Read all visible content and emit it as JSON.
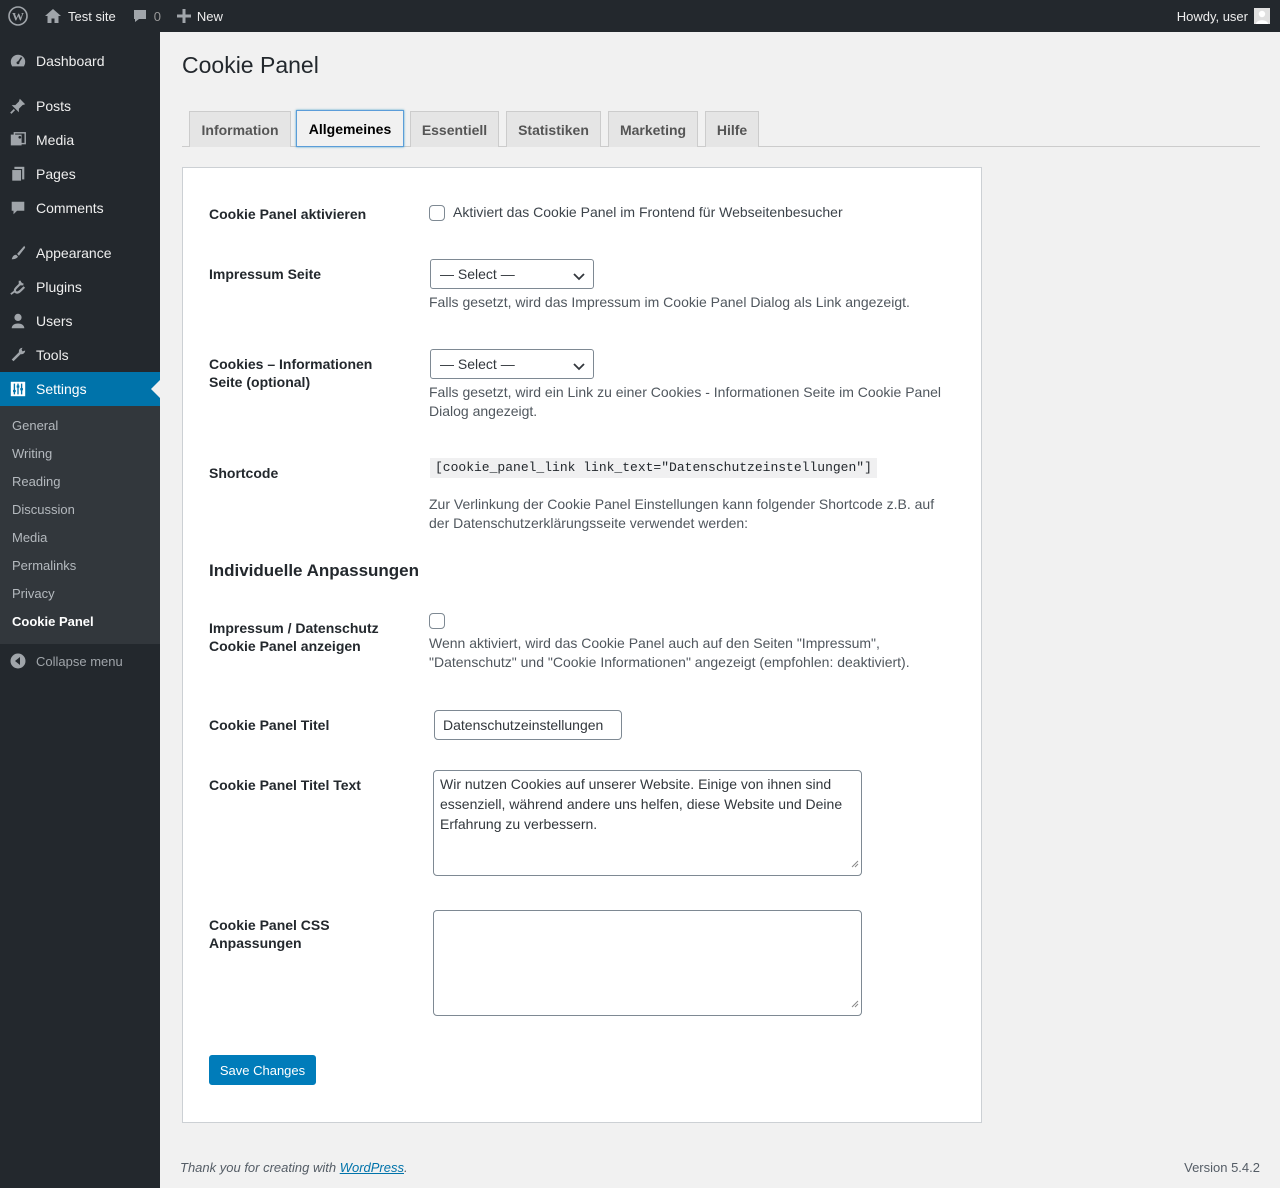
{
  "adminbar": {
    "site_name": "Test site",
    "comments_count": "0",
    "new_label": "New",
    "howdy": "Howdy, user"
  },
  "sidebar": {
    "items": [
      {
        "label": "Dashboard",
        "icon": "dashboard-icon"
      },
      {
        "label": "Posts",
        "icon": "pin-icon"
      },
      {
        "label": "Media",
        "icon": "media-icon"
      },
      {
        "label": "Pages",
        "icon": "pages-icon"
      },
      {
        "label": "Comments",
        "icon": "comment-icon"
      },
      {
        "label": "Appearance",
        "icon": "brush-icon"
      },
      {
        "label": "Plugins",
        "icon": "plug-icon"
      },
      {
        "label": "Users",
        "icon": "user-icon"
      },
      {
        "label": "Tools",
        "icon": "wrench-icon"
      },
      {
        "label": "Settings",
        "icon": "sliders-icon"
      }
    ],
    "submenu": [
      "General",
      "Writing",
      "Reading",
      "Discussion",
      "Media",
      "Permalinks",
      "Privacy",
      "Cookie Panel"
    ],
    "collapse_label": "Collapse menu"
  },
  "page": {
    "title": "Cookie Panel",
    "tabs": [
      "Information",
      "Allgemeines",
      "Essentiell",
      "Statistiken",
      "Marketing",
      "Hilfe"
    ],
    "active_tab": "Allgemeines"
  },
  "form": {
    "activate": {
      "label": "Cookie Panel aktivieren",
      "checkbox_label": "Aktiviert das Cookie Panel im Frontend für Webseitenbesucher"
    },
    "impressum": {
      "label": "Impressum Seite",
      "select_value": "— Select —",
      "description": "Falls gesetzt, wird das Impressum im Cookie Panel Dialog als Link angezeigt."
    },
    "cookies_info": {
      "label": "Cookies – Informationen Seite (optional)",
      "select_value": "— Select —",
      "description": "Falls gesetzt, wird ein Link zu einer Cookies - Informationen Seite im Cookie Panel Dialog angezeigt."
    },
    "shortcode": {
      "label": "Shortcode",
      "code": "[cookie_panel_link link_text=\"Datenschutzeinstellungen\"]",
      "description": "Zur Verlinkung der Cookie Panel Einstellungen kann folgender Shortcode z.B. auf der Datenschutzerklärungsseite verwendet werden:"
    },
    "section_heading": "Individuelle Anpassungen",
    "show_on_pages": {
      "label": "Impressum / Datenschutz Cookie Panel anzeigen",
      "description": "Wenn aktiviert, wird das Cookie Panel auch auf den Seiten \"Impressum\", \"Datenschutz\" und \"Cookie Informationen\" angezeigt (empfohlen: deaktiviert)."
    },
    "title": {
      "label": "Cookie Panel Titel",
      "value": "Datenschutzeinstellungen"
    },
    "title_text": {
      "label": "Cookie Panel Titel Text",
      "value": "Wir nutzen Cookies auf unserer Website. Einige von ihnen sind essenziell, während andere uns helfen, diese Website und Deine Erfahrung zu verbessern."
    },
    "css": {
      "label": "Cookie Panel CSS Anpassungen",
      "value": ""
    },
    "save_label": "Save Changes"
  },
  "footer": {
    "thanks_prefix": "Thank you for creating with ",
    "thanks_link": "WordPress",
    "thanks_suffix": ".",
    "version": "Version 5.4.2"
  },
  "colors": {
    "admin_dark": "#23282d",
    "accent": "#0073aa",
    "button": "#007cba"
  }
}
